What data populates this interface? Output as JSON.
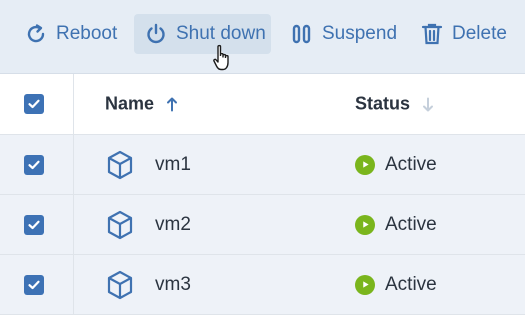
{
  "toolbar": {
    "reboot_label": "Reboot",
    "shutdown_label": "Shut down",
    "suspend_label": "Suspend",
    "delete_label": "Delete"
  },
  "table": {
    "columns": {
      "name": "Name",
      "status": "Status"
    },
    "rows": [
      {
        "name": "vm1",
        "status": "Active"
      },
      {
        "name": "vm2",
        "status": "Active"
      },
      {
        "name": "vm3",
        "status": "Active"
      }
    ]
  },
  "colors": {
    "accent": "#3f72b1",
    "active_status": "#7ab51d",
    "toolbar_bg": "#e6edf5"
  },
  "icons": {
    "reboot": "reboot-icon",
    "shutdown": "power-icon",
    "suspend": "pause-icon",
    "delete": "trash-icon",
    "vm": "cube-icon"
  }
}
